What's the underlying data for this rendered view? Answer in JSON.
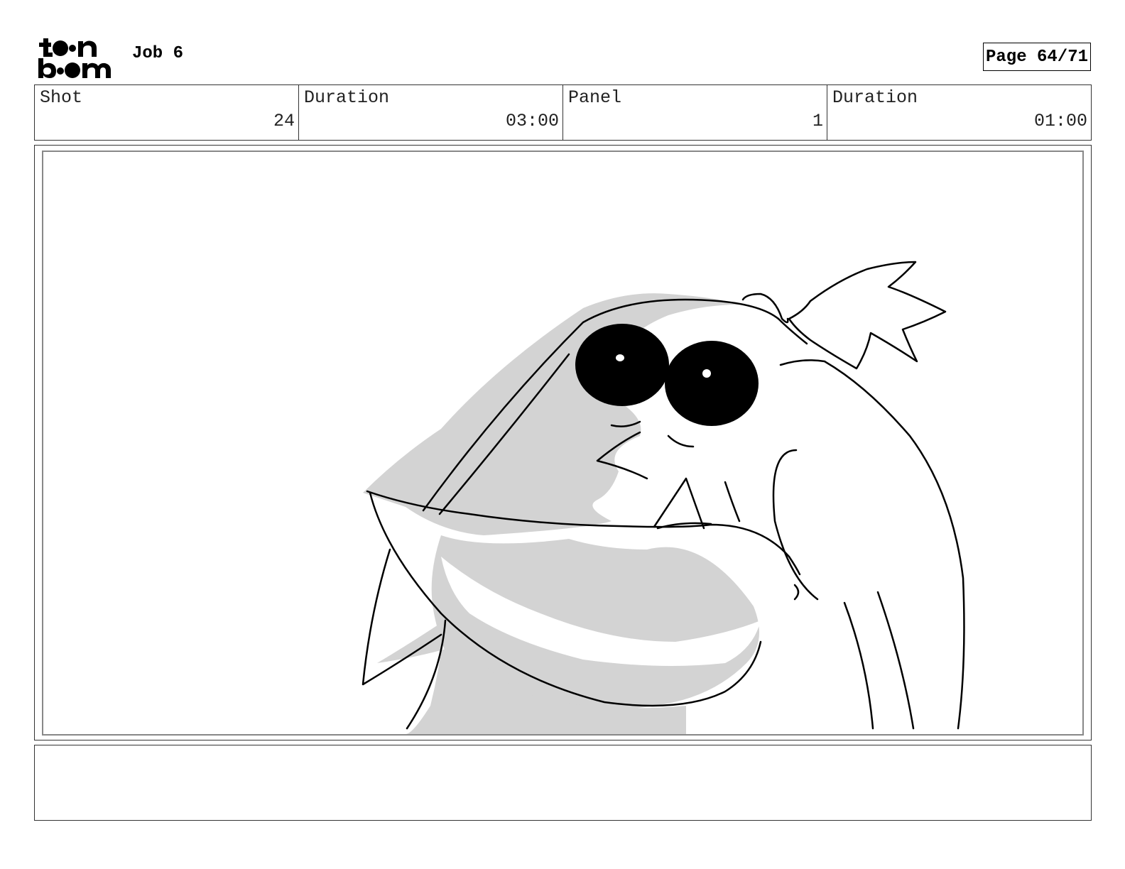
{
  "header": {
    "logo": "toon boom",
    "job_title": "Job 6",
    "page_label": "Page 64/71"
  },
  "info": {
    "shot_label": "Shot",
    "shot_value": "24",
    "shot_duration_label": "Duration",
    "shot_duration_value": "03:00",
    "panel_label": "Panel",
    "panel_value": "1",
    "panel_duration_label": "Duration",
    "panel_duration_value": "01:00"
  },
  "panel": {
    "image": "shark-character-sketch",
    "shade_color": "#d3d3d3"
  },
  "notes": {
    "text": ""
  }
}
